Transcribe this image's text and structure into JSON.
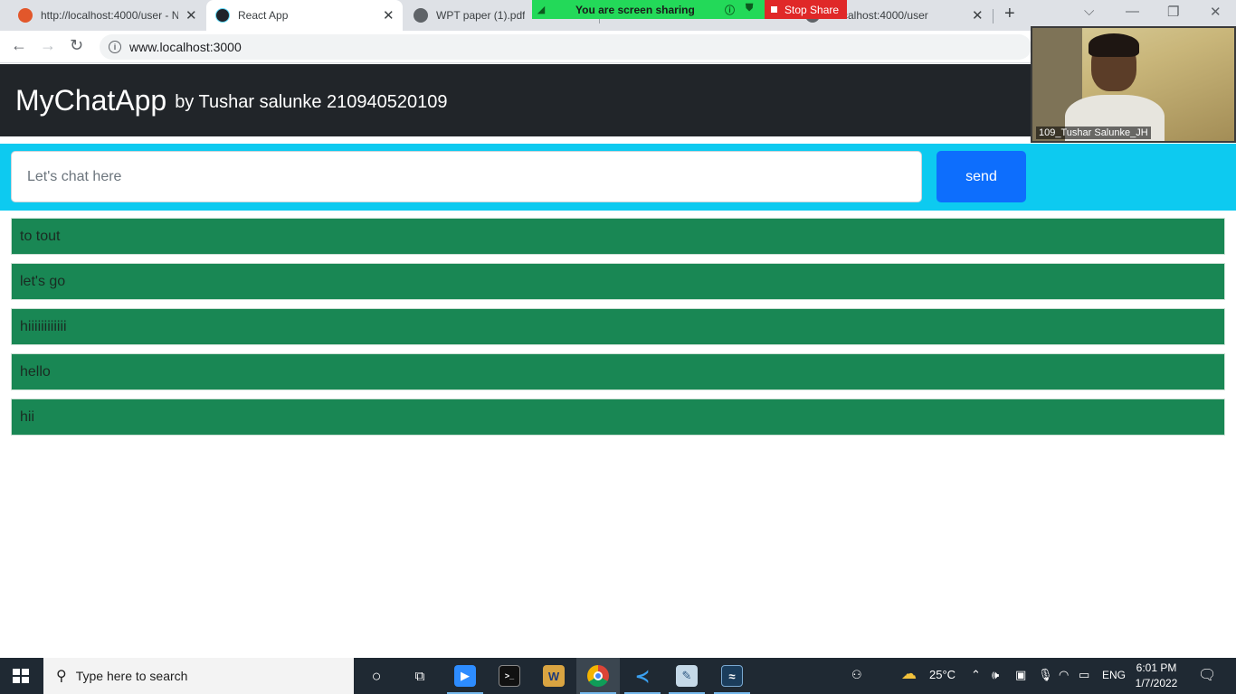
{
  "browser": {
    "tabs": [
      {
        "title": "http://localhost:4000/user - N",
        "active": false,
        "favicon": "firefox-like-icon"
      },
      {
        "title": "React App",
        "active": true,
        "favicon": "react-icon"
      },
      {
        "title": "WPT paper (1).pdf",
        "active": false,
        "favicon": "globe-icon"
      },
      {
        "title": "/.localhost:4000/user",
        "active": false,
        "favicon": "globe-icon"
      }
    ],
    "url": "www.localhost:3000"
  },
  "zoom": {
    "sharing_text": "You are screen sharing",
    "stop_share_label": "Stop Share",
    "participant_name": "109_Tushar Salunke_JH"
  },
  "app": {
    "title": "MyChatApp",
    "subtitle": "by Tushar salunke 210940520109",
    "input_placeholder": "Let's chat here",
    "input_value": "",
    "send_label": "send",
    "messages": [
      "to tout",
      "let's go",
      "hiiiiiiiiiiii",
      "hello",
      "hii"
    ],
    "colors": {
      "header_bg": "#212529",
      "input_bar_bg": "#0dcaf0",
      "send_button_bg": "#0d6efd",
      "message_bg": "#198754"
    }
  },
  "taskbar": {
    "search_placeholder": "Type here to search",
    "weather": "25°C",
    "language": "ENG",
    "time": "6:01 PM",
    "date": "1/7/2022"
  }
}
